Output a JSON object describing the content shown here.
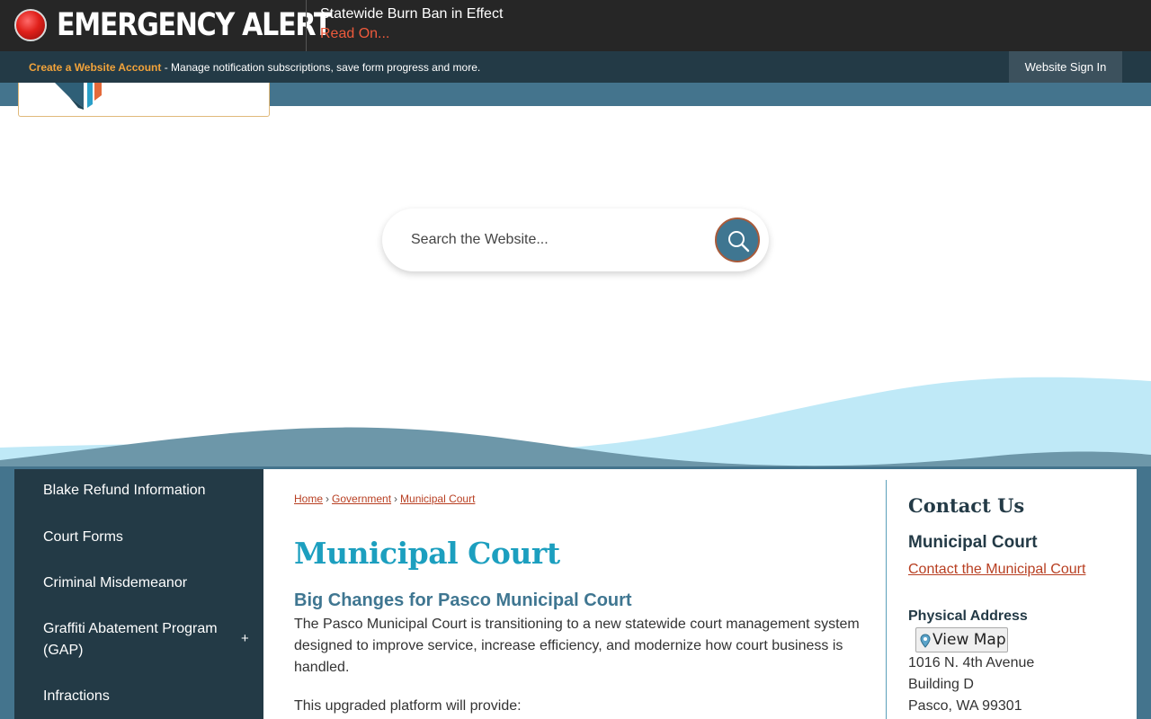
{
  "alert": {
    "title": "EMERGENCY ALERT",
    "headline": "Statewide Burn Ban in Effect",
    "link": "Read On..."
  },
  "account": {
    "create_link": "Create a Website Account",
    "description": " - Manage notification subscriptions, save form progress and more.",
    "sign_in": "Website Sign In"
  },
  "search": {
    "placeholder": "Search the Website..."
  },
  "sidebar": {
    "items": [
      {
        "label": "Blake Refund Information"
      },
      {
        "label": "Court Forms"
      },
      {
        "label": "Criminal Misdemeanor"
      },
      {
        "label": "Graffiti Abatement Program (GAP)"
      },
      {
        "label": "Infractions"
      }
    ],
    "expand_symbol": "+"
  },
  "breadcrumb": {
    "items": [
      "Home",
      "Government",
      "Municipal Court"
    ],
    "separator": "›"
  },
  "main": {
    "title": "Municipal Court",
    "subheading": "Big Changes for Pasco Municipal Court",
    "paragraph": "The Pasco Municipal Court is transitioning to a new statewide court management system designed to improve service, increase efficiency, and modernize how court business is handled.",
    "paragraph2": "This upgraded platform will provide:"
  },
  "contact": {
    "title": "Contact Us",
    "name": "Municipal Court",
    "link": "Contact the Municipal Court",
    "address_label": "Physical Address",
    "map_button": "View Map",
    "address_lines": [
      "1016 N. 4th Avenue",
      "Building D",
      "Pasco, WA 99301"
    ]
  },
  "colors": {
    "alert_bg": "#262626",
    "account_bg": "#233a46",
    "accent_orange": "#f2a33a",
    "link_red": "#b83f22",
    "title_blue": "#1c9fbf",
    "nav_teal": "#44748d"
  }
}
